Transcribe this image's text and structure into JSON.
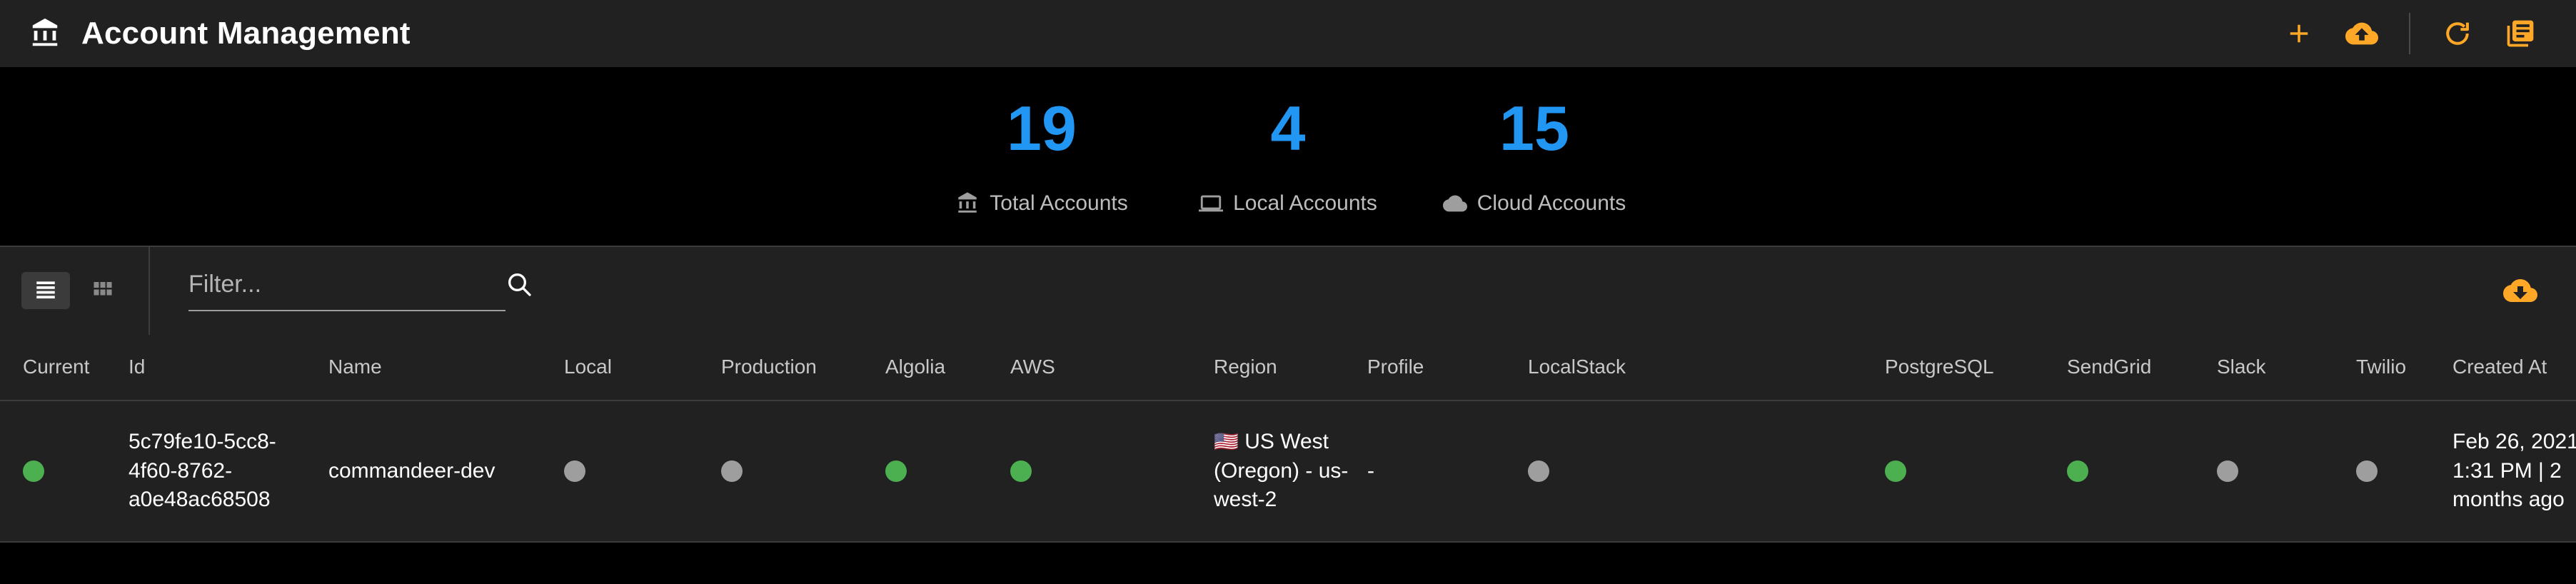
{
  "appbar": {
    "title": "Account Management",
    "logo_icon": "bank-icon",
    "actions": [
      {
        "name": "add-account-button",
        "icon": "plus-icon"
      },
      {
        "name": "upload-accounts-button",
        "icon": "cloud-upload-icon"
      },
      {
        "name": "refresh-button",
        "icon": "refresh-icon"
      },
      {
        "name": "logs-button",
        "icon": "library-books-icon"
      }
    ]
  },
  "stats": [
    {
      "value": "19",
      "label": "Total Accounts",
      "icon": "bank-icon",
      "color": "#2196f3"
    },
    {
      "value": "4",
      "label": "Local Accounts",
      "icon": "laptop-icon",
      "color": "#2196f3"
    },
    {
      "value": "15",
      "label": "Cloud Accounts",
      "icon": "cloud-icon",
      "color": "#2196f3"
    }
  ],
  "toolbar": {
    "list_view_icon": "list-view-icon",
    "grid_view_icon": "grid-view-icon",
    "active_view": "list",
    "filter_placeholder": "Filter...",
    "filter_value": "",
    "search_icon": "search-icon",
    "download_icon": "cloud-download-icon"
  },
  "table": {
    "columns": [
      "Current",
      "Id",
      "Name",
      "Local",
      "Production",
      "Algolia",
      "AWS",
      "Region",
      "Profile",
      "LocalStack",
      "PostgreSQL",
      "SendGrid",
      "Slack",
      "Twilio",
      "Created At"
    ],
    "rows": [
      {
        "current": "green",
        "id": "5c79fe10-5cc8-4f60-8762-a0e48ac68508",
        "name": "commandeer-dev",
        "local": "grey",
        "production": "grey",
        "algolia": "green",
        "aws": "green",
        "region_flag": "🇺🇸",
        "region": "US West (Oregon) - us-west-2",
        "profile": "-",
        "localstack": "grey",
        "postgresql": "green",
        "sendgrid": "green",
        "slack": "grey",
        "twilio": "grey",
        "created_at": "Feb 26, 2021 1:31 PM | 2 months ago"
      }
    ]
  },
  "colors": {
    "accent": "#ffa726",
    "stat_number": "#2196f3",
    "status_on": "#4caf50",
    "status_off": "#9e9e9e",
    "appbar_bg": "#212121",
    "page_bg": "#000000"
  }
}
